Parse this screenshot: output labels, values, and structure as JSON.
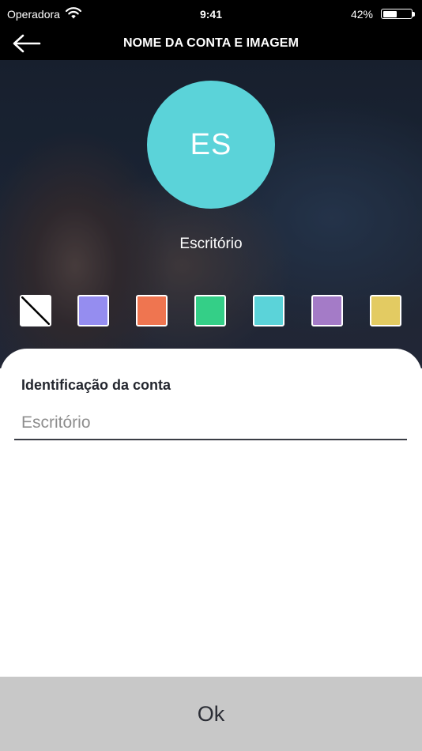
{
  "status_bar": {
    "carrier": "Operadora",
    "time": "9:41",
    "battery": "42%"
  },
  "nav": {
    "title": "NOME DA CONTA E IMAGEM",
    "back_icon": "arrow-left-icon"
  },
  "avatar": {
    "initials": "ES",
    "color": "#5bd3d9"
  },
  "account_name": "Escritório",
  "swatches": [
    {
      "name": "none",
      "color": "#ffffff"
    },
    {
      "name": "lavender",
      "color": "#958df0"
    },
    {
      "name": "coral",
      "color": "#ef7550"
    },
    {
      "name": "green",
      "color": "#34cf87"
    },
    {
      "name": "turquoise",
      "color": "#5bd3d9"
    },
    {
      "name": "purple",
      "color": "#a47bc7"
    },
    {
      "name": "mustard",
      "color": "#e3cb62"
    }
  ],
  "form": {
    "label": "Identificação da conta",
    "placeholder": "Escritório",
    "value": ""
  },
  "ok_button": {
    "label": "Ok"
  }
}
